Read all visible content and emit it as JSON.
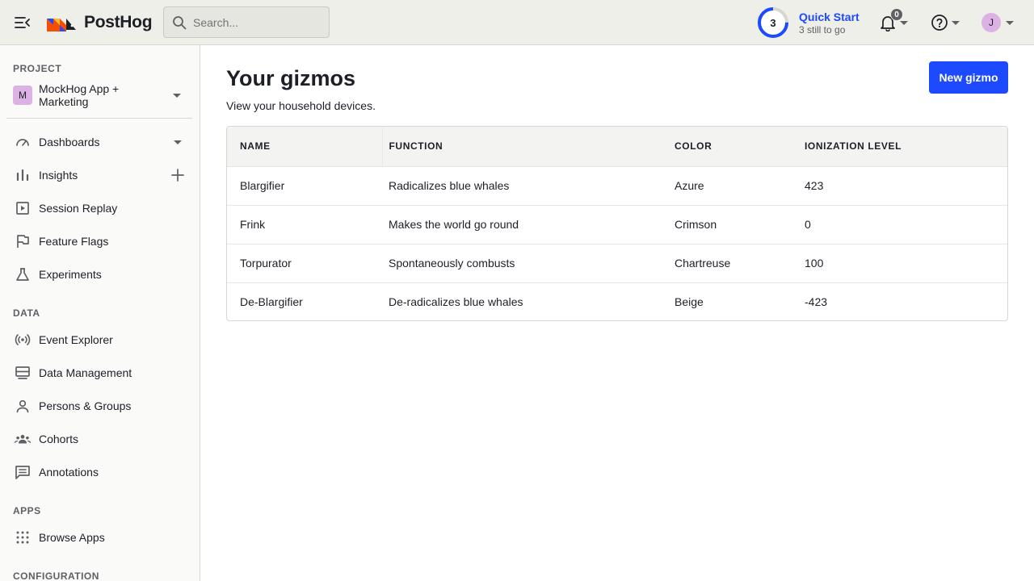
{
  "header": {
    "brand": "PostHog",
    "search_placeholder": "Search...",
    "quick_start": {
      "count": "3",
      "title": "Quick Start",
      "subtitle": "3 still to go",
      "progress": 0.25
    },
    "notifications_count": "0",
    "user_initial": "J"
  },
  "sidebar": {
    "project_label": "PROJECT",
    "project_initial": "M",
    "project_name": "MockHog App + Marketing",
    "nav": [
      {
        "label": "Dashboards",
        "icon": "dashboard-icon"
      },
      {
        "label": "Insights",
        "icon": "insights-icon"
      },
      {
        "label": "Session Replay",
        "icon": "session-replay-icon"
      },
      {
        "label": "Feature Flags",
        "icon": "flag-icon"
      },
      {
        "label": "Experiments",
        "icon": "flask-icon"
      }
    ],
    "data_label": "DATA",
    "data_nav": [
      {
        "label": "Event Explorer",
        "icon": "broadcast-icon"
      },
      {
        "label": "Data Management",
        "icon": "database-icon"
      },
      {
        "label": "Persons & Groups",
        "icon": "person-icon"
      },
      {
        "label": "Cohorts",
        "icon": "cohorts-icon"
      },
      {
        "label": "Annotations",
        "icon": "annotation-icon"
      }
    ],
    "apps_label": "APPS",
    "apps_nav": [
      {
        "label": "Browse Apps",
        "icon": "apps-grid-icon"
      }
    ],
    "config_label": "CONFIGURATION"
  },
  "main": {
    "title": "Your gizmos",
    "subtitle": "View your household devices.",
    "new_button": "New gizmo",
    "columns": [
      "NAME",
      "FUNCTION",
      "COLOR",
      "IONIZATION LEVEL"
    ],
    "rows": [
      {
        "name": "Blargifier",
        "function": "Radicalizes blue whales",
        "color": "Azure",
        "ionization": "423"
      },
      {
        "name": "Frink",
        "function": "Makes the world go round",
        "color": "Crimson",
        "ionization": "0"
      },
      {
        "name": "Torpurator",
        "function": "Spontaneously combusts",
        "color": "Chartreuse",
        "ionization": "100"
      },
      {
        "name": "De-Blargifier",
        "function": "De-radicalizes blue whales",
        "color": "Beige",
        "ionization": "-423"
      }
    ]
  },
  "colors": {
    "accent": "#1d4aff",
    "avatar": "#dcb1e3"
  }
}
